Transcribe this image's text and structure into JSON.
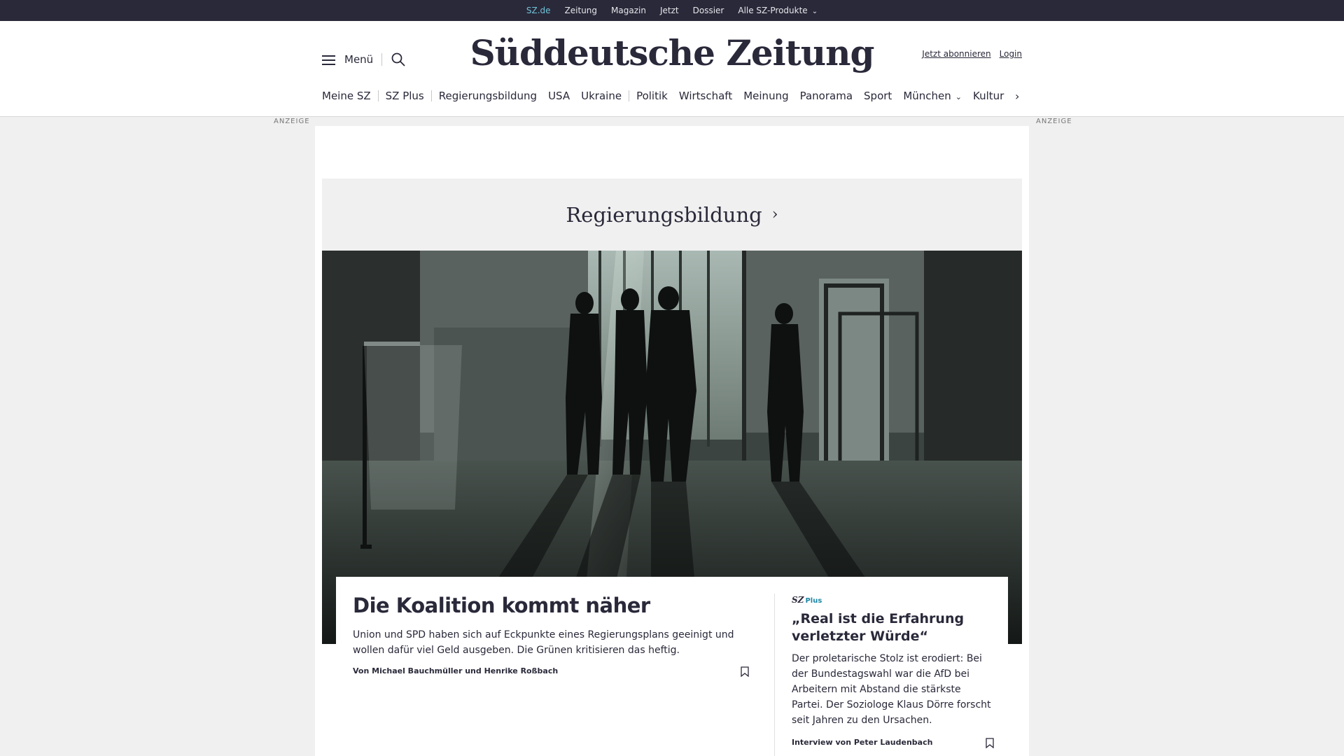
{
  "topbar": {
    "items": [
      "SZ.de",
      "Zeitung",
      "Magazin",
      "Jetzt",
      "Dossier"
    ],
    "products_label": "Alle SZ-Produkte"
  },
  "header": {
    "menu_label": "Menü",
    "logo": "Süddeutsche Zeitung",
    "subscribe_label": "Jetzt abonnieren",
    "login_label": "Login"
  },
  "nav": {
    "items": [
      "Meine SZ",
      "SZ Plus",
      "Regierungsbildung",
      "USA",
      "Ukraine",
      "Politik",
      "Wirtschaft",
      "Meinung",
      "Panorama",
      "Sport",
      "München",
      "Kultur"
    ]
  },
  "ad_label": "ANZEIGE",
  "section": {
    "title": "Regierungsbildung"
  },
  "lead": {
    "headline": "Die Koalition kommt näher",
    "teaser": "Union und SPD haben sich auf Eckpunkte eines Regierungsplans geeinigt und wollen dafür viel Geld ausgeben. Die Grünen kritisieren das heftig.",
    "byline": "Von Michael Bauchmüller und Henrike Roßbach"
  },
  "side": {
    "brand": "SZ",
    "brand_suffix": "Plus",
    "headline": "„Real ist die Erfahrung verletzter Würde“",
    "teaser": "Der proletarische Stolz ist erodiert: Bei der Bundestagswahl war die AfD bei Arbeitern mit Abstand die stärkste Partei. Der Soziologe Klaus Dörre forscht seit Jahren zu den Ursachen.",
    "byline": "Interview von Peter Laudenbach"
  },
  "colors": {
    "dark": "#29293a",
    "accent": "#71c3d6",
    "background": "#f0f0f0"
  },
  "icons": [
    "hamburger-icon",
    "search-icon",
    "chevron-down-icon",
    "chevron-right-icon",
    "bookmark-icon"
  ]
}
